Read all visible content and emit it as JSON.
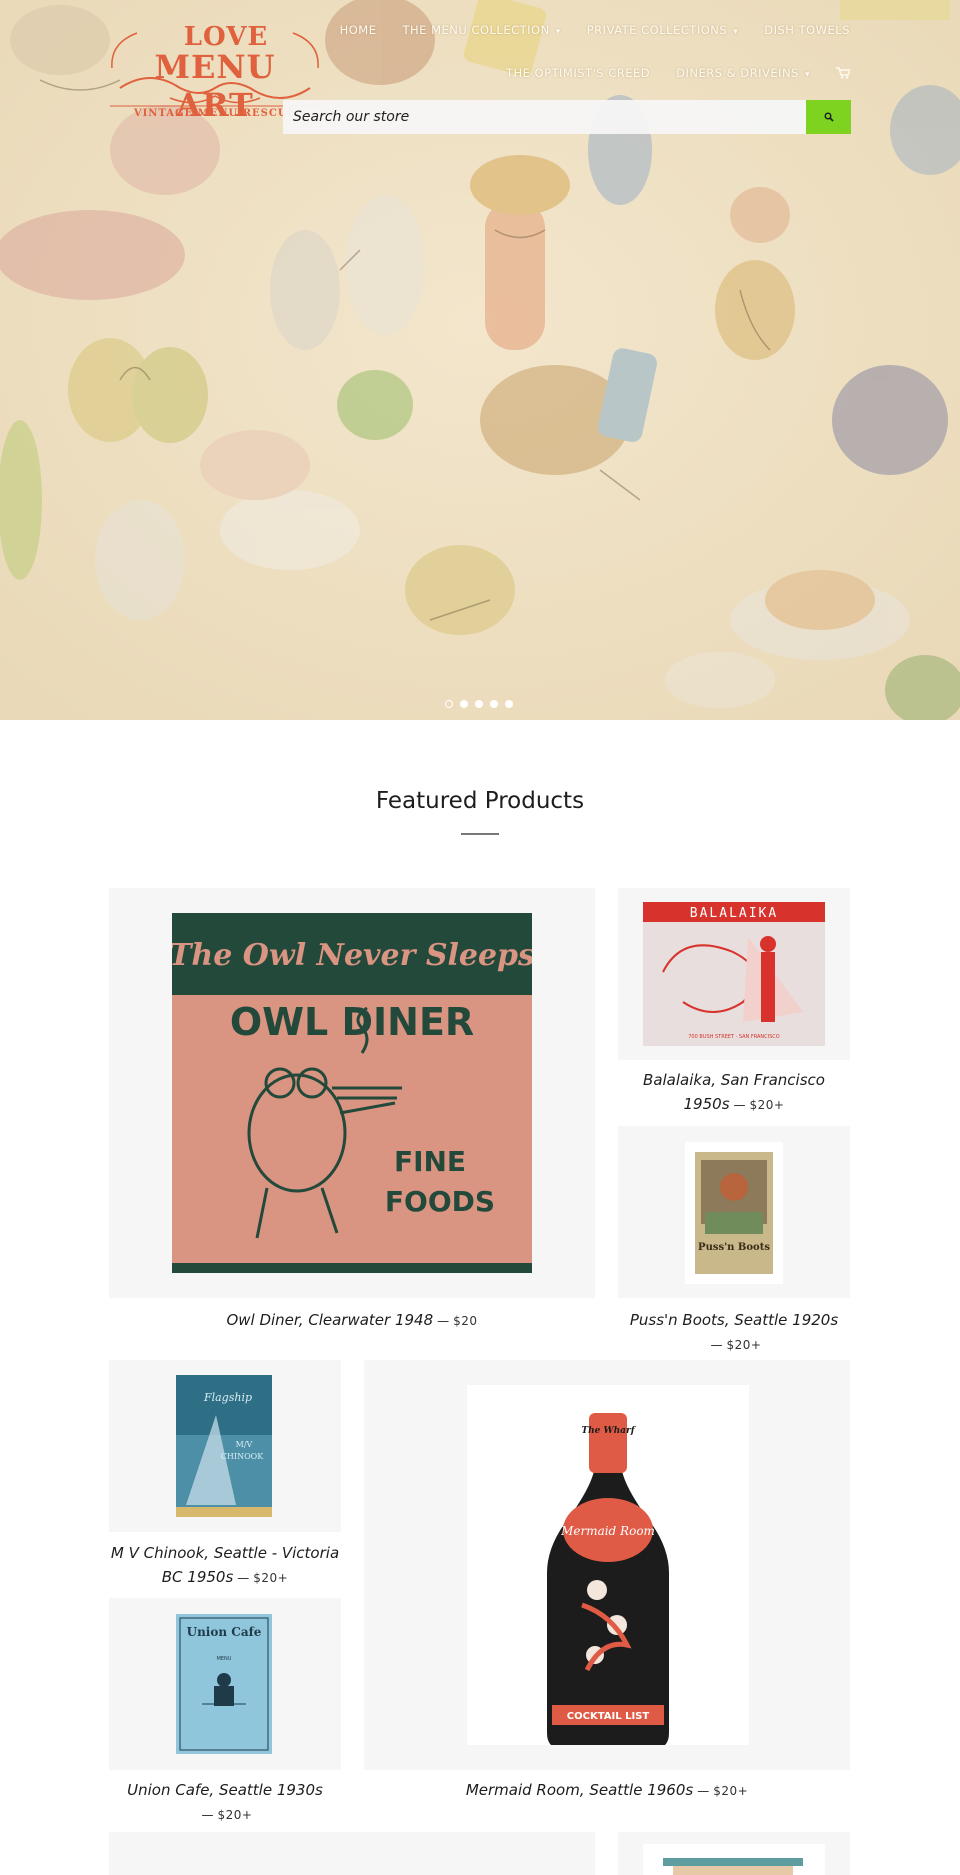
{
  "logo": {
    "line1": "LOVE",
    "line2": "MENU ART",
    "tagline": "VINTAGE MENU RESCUE"
  },
  "nav": {
    "row1": [
      {
        "label": "HOME",
        "dropdown": false
      },
      {
        "label": "THE MENU COLLECTION",
        "dropdown": true
      },
      {
        "label": "PRIVATE COLLECTIONS",
        "dropdown": true
      },
      {
        "label": "DISH TOWELS",
        "dropdown": false
      }
    ],
    "row2": [
      {
        "label": "THE OPTIMIST'S CREED",
        "dropdown": false
      },
      {
        "label": "DINERS & DRIVEINS",
        "dropdown": true
      }
    ]
  },
  "search": {
    "placeholder": "Search our store"
  },
  "slideshow": {
    "dot_count": 5,
    "active_index": 0
  },
  "featured": {
    "title": "Featured Products",
    "dash": "—",
    "products": [
      {
        "name": "Owl Diner, Clearwater 1948",
        "price": "$20"
      },
      {
        "name": "Balalaika, San Francisco 1950s",
        "price": "$20+"
      },
      {
        "name": "Puss'n Boots, Seattle 1920s",
        "price": "$20+"
      },
      {
        "name": "M V Chinook, Seattle - Victoria BC 1950s",
        "price": "$20+"
      },
      {
        "name": "Union Cafe, Seattle 1930s",
        "price": "$20+"
      },
      {
        "name": "Mermaid Room, Seattle 1960s",
        "price": "$20+"
      }
    ]
  },
  "artwork": {
    "owl": {
      "top": "The Owl Never Sleeps",
      "name": "OWL DINER",
      "line1": "FINE",
      "line2": "FOODS"
    },
    "balalaika": {
      "name": "BALALAIKA",
      "foot": "700 BUSH STREET · SAN FRANCISCO"
    },
    "pussnboots": {
      "name": "Puss'n Boots"
    },
    "chinook": {
      "line1": "Flagship",
      "line2": "M/V",
      "line3": "CHINOOK"
    },
    "union": {
      "name": "Union Cafe",
      "line2": "MENU"
    },
    "mermaid": {
      "top": "The Wharf",
      "name": "Mermaid Room",
      "foot": "COCKTAIL LIST"
    }
  },
  "colors": {
    "accent_green": "#7ed321",
    "logo_orange": "#e0613d",
    "card_bg": "#f6f6f6"
  }
}
